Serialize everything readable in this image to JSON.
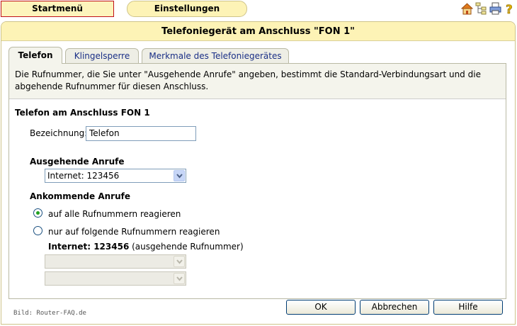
{
  "nav": {
    "start_label": "Startmenü",
    "settings_label": "Einstellungen"
  },
  "icons": [
    "home-icon",
    "sitemap-icon",
    "printer-icon",
    "help-icon"
  ],
  "panel": {
    "title": "Telefoniegerät am Anschluss \"FON 1\""
  },
  "tabs": [
    {
      "label": "Telefon",
      "active": true
    },
    {
      "label": "Klingelsperre",
      "active": false
    },
    {
      "label": "Merkmale des Telefoniegerätes",
      "active": false
    }
  ],
  "intro_text": "Die Rufnummer, die Sie unter \"Ausgehende Anrufe\" angeben, bestimmt die Standard-Verbindungsart und die abgehende Rufnummer für diesen Anschluss.",
  "form": {
    "section_title": "Telefon am Anschluss FON 1",
    "bezeichnung_label": "Bezeichnung:",
    "bezeichnung_value": "Telefon",
    "outgoing_title": "Ausgehende Anrufe",
    "outgoing_value": "Internet: 123456",
    "incoming_title": "Ankommende Anrufe",
    "radio_all_label": "auf alle Rufnummern reagieren",
    "radio_specific_label": "nur auf folgende Rufnummern reagieren",
    "radio_selected": "all",
    "number_bold": "Internet: 123456",
    "number_note": "(ausgehende Rufnummer)",
    "extra_select_1_value": "",
    "extra_select_2_value": ""
  },
  "buttons": {
    "ok": "OK",
    "cancel": "Abbrechen",
    "help": "Hilfe"
  },
  "credit": "Bild: Router-FAQ.de",
  "colors": {
    "header_bg": "#fdf3b6",
    "tab_text": "#1a2f86",
    "radio_checked": "#21a121",
    "start_border": "#c0101a"
  }
}
